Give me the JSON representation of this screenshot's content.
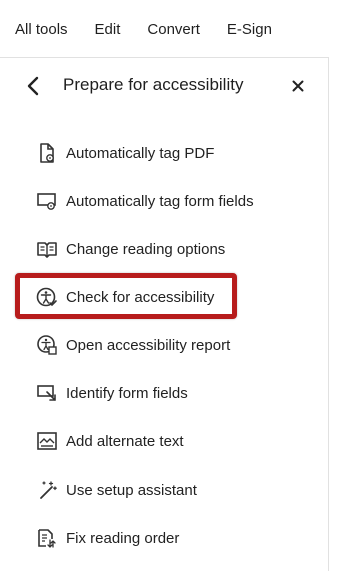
{
  "menu": {
    "tabs": [
      "All tools",
      "Edit",
      "Convert",
      "E-Sign"
    ]
  },
  "panel": {
    "title": "Prepare for accessibility",
    "back_icon": "chevron-left-icon",
    "close_icon": "close-icon"
  },
  "tools": [
    {
      "label": "Automatically tag PDF",
      "icon": "autotag-pdf-icon"
    },
    {
      "label": "Automatically tag form fields",
      "icon": "autotag-form-fields-icon"
    },
    {
      "label": "Change reading options",
      "icon": "reading-options-icon"
    },
    {
      "label": "Check for accessibility",
      "icon": "accessibility-check-icon",
      "highlighted": true
    },
    {
      "label": "Open accessibility report",
      "icon": "accessibility-report-icon"
    },
    {
      "label": "Identify form fields",
      "icon": "identify-form-fields-icon"
    },
    {
      "label": "Add alternate text",
      "icon": "alternate-text-icon"
    },
    {
      "label": "Use setup assistant",
      "icon": "setup-assistant-icon"
    },
    {
      "label": "Fix reading order",
      "icon": "reading-order-icon"
    }
  ],
  "colors": {
    "highlight": "#b71c1c",
    "text": "#222222",
    "divider": "#e1e1e1"
  }
}
